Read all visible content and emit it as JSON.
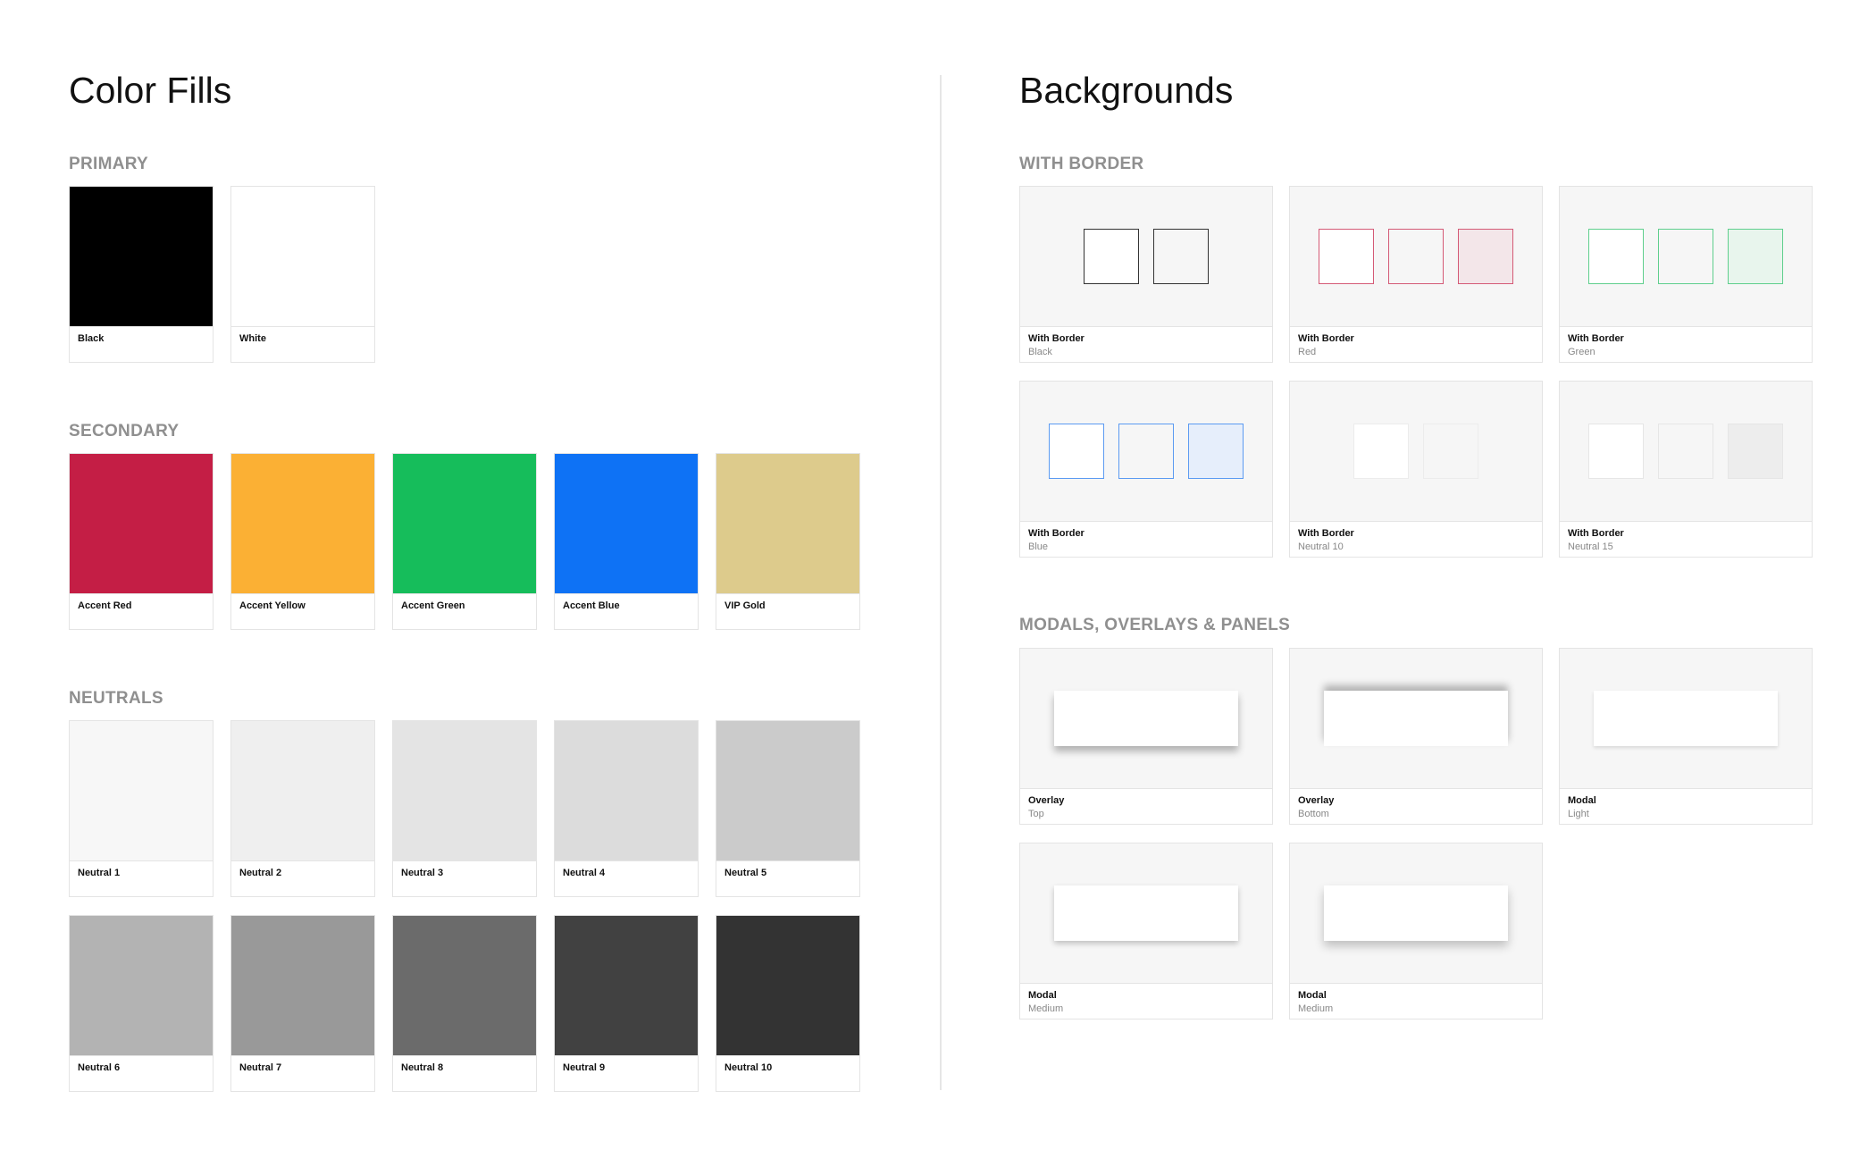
{
  "left": {
    "title": "Color Fills",
    "primary": {
      "heading": "PRIMARY",
      "swatches": [
        {
          "label": "Black",
          "color": "#000000"
        },
        {
          "label": "White",
          "color": "#ffffff"
        }
      ]
    },
    "secondary": {
      "heading": "SECONDARY",
      "swatches": [
        {
          "label": "Accent Red",
          "color": "#c41e45"
        },
        {
          "label": "Accent Yellow",
          "color": "#fbb034"
        },
        {
          "label": "Accent Green",
          "color": "#16bd5b"
        },
        {
          "label": "Accent Blue",
          "color": "#0e72f5"
        },
        {
          "label": "VIP Gold",
          "color": "#ddcb8c"
        }
      ]
    },
    "neutrals": {
      "heading": "NEUTRALS",
      "swatches": [
        {
          "label": "Neutral 1",
          "color": "#f7f7f7"
        },
        {
          "label": "Neutral 2",
          "color": "#efefef"
        },
        {
          "label": "Neutral 3",
          "color": "#e4e4e4"
        },
        {
          "label": "Neutral 4",
          "color": "#dcdcdc"
        },
        {
          "label": "Neutral 5",
          "color": "#cbcbcb"
        },
        {
          "label": "Neutral 6",
          "color": "#b3b3b3"
        },
        {
          "label": "Neutral 7",
          "color": "#999999"
        },
        {
          "label": "Neutral 8",
          "color": "#6b6b6b"
        },
        {
          "label": "Neutral 9",
          "color": "#414141"
        },
        {
          "label": "Neutral 10",
          "color": "#333333"
        }
      ]
    }
  },
  "right": {
    "title": "Backgrounds",
    "with_border": {
      "heading": "WITH BORDER",
      "cards": [
        {
          "label": "With Border",
          "sublabel": "Black",
          "border": "#333333",
          "fills": [
            "#ffffff",
            "#f6f6f6"
          ]
        },
        {
          "label": "With Border",
          "sublabel": "Red",
          "border": "#d45a76",
          "fills": [
            "#ffffff",
            "#f6f6f6",
            "#f3e6e9"
          ]
        },
        {
          "label": "With Border",
          "sublabel": "Green",
          "border": "#5fcf8d",
          "fills": [
            "#ffffff",
            "#f6f6f6",
            "#e8f5ed"
          ]
        },
        {
          "label": "With Border",
          "sublabel": "Blue",
          "border": "#5c9bf2",
          "fills": [
            "#ffffff",
            "#f6f6f6",
            "#e6eefb"
          ]
        },
        {
          "label": "With Border",
          "sublabel": "Neutral 10",
          "border": "#ececec",
          "fills": [
            "#ffffff",
            "#f6f6f6"
          ]
        },
        {
          "label": "With Border",
          "sublabel": "Neutral 15",
          "border": "#e6e6e6",
          "fills": [
            "#ffffff",
            "#f6f6f6",
            "#ededed"
          ]
        }
      ]
    },
    "modals": {
      "heading": "MODALS, OVERLAYS & PANELS",
      "cards": [
        {
          "label": "Overlay",
          "sublabel": "Top",
          "shadow": "0 6px 8px rgba(0,0,0,0.28)"
        },
        {
          "label": "Overlay",
          "sublabel": "Bottom",
          "shadow": "0 -6px 8px rgba(0,0,0,0.28)"
        },
        {
          "label": "Modal",
          "sublabel": "Light",
          "shadow": "0 2px 4px rgba(0,0,0,0.12)"
        },
        {
          "label": "Modal",
          "sublabel": "Medium",
          "shadow": "0 3px 6px rgba(0,0,0,0.22)"
        },
        {
          "label": "Modal",
          "sublabel": "Medium",
          "shadow": "0 6px 10px rgba(0,0,0,0.22)"
        }
      ]
    }
  }
}
